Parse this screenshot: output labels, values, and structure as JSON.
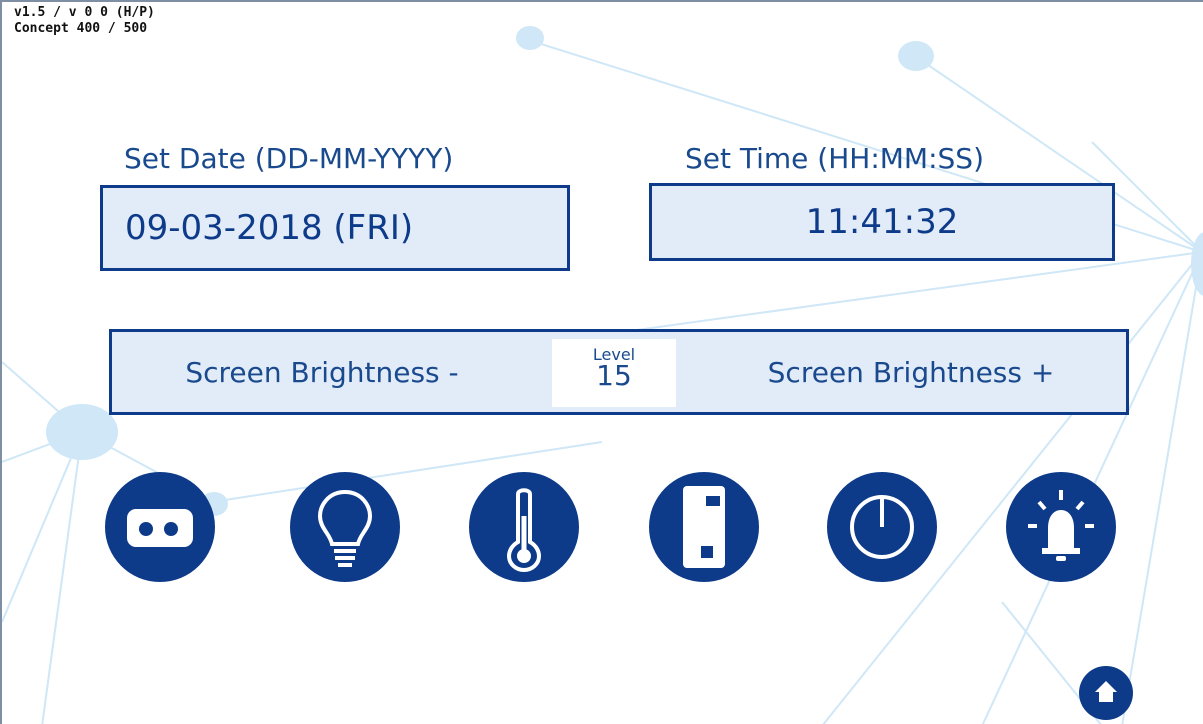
{
  "version": {
    "line1": "v1.5 /    v 0 0 (H/P)",
    "line2": "Concept 400 / 500"
  },
  "date": {
    "label": "Set Date (DD-MM-YYYY)",
    "value": "09-03-2018 (FRI)"
  },
  "time": {
    "label": "Set Time (HH:MM:SS)",
    "value": "11:41:32"
  },
  "brightness": {
    "decrease_label": "Screen Brightness -",
    "increase_label": "Screen Brightness +",
    "level_caption": "Level",
    "level_value": "15"
  },
  "icons": [
    "cassette-icon",
    "lightbulb-icon",
    "thermometer-icon",
    "dispenser-icon",
    "power-icon",
    "alarm-bell-icon",
    "home-icon"
  ],
  "colors": {
    "primary": "#0d3b8a",
    "text": "#1a4a8e",
    "field_bg": "#e2ebf8",
    "network_bg": "#cfe7f6"
  }
}
